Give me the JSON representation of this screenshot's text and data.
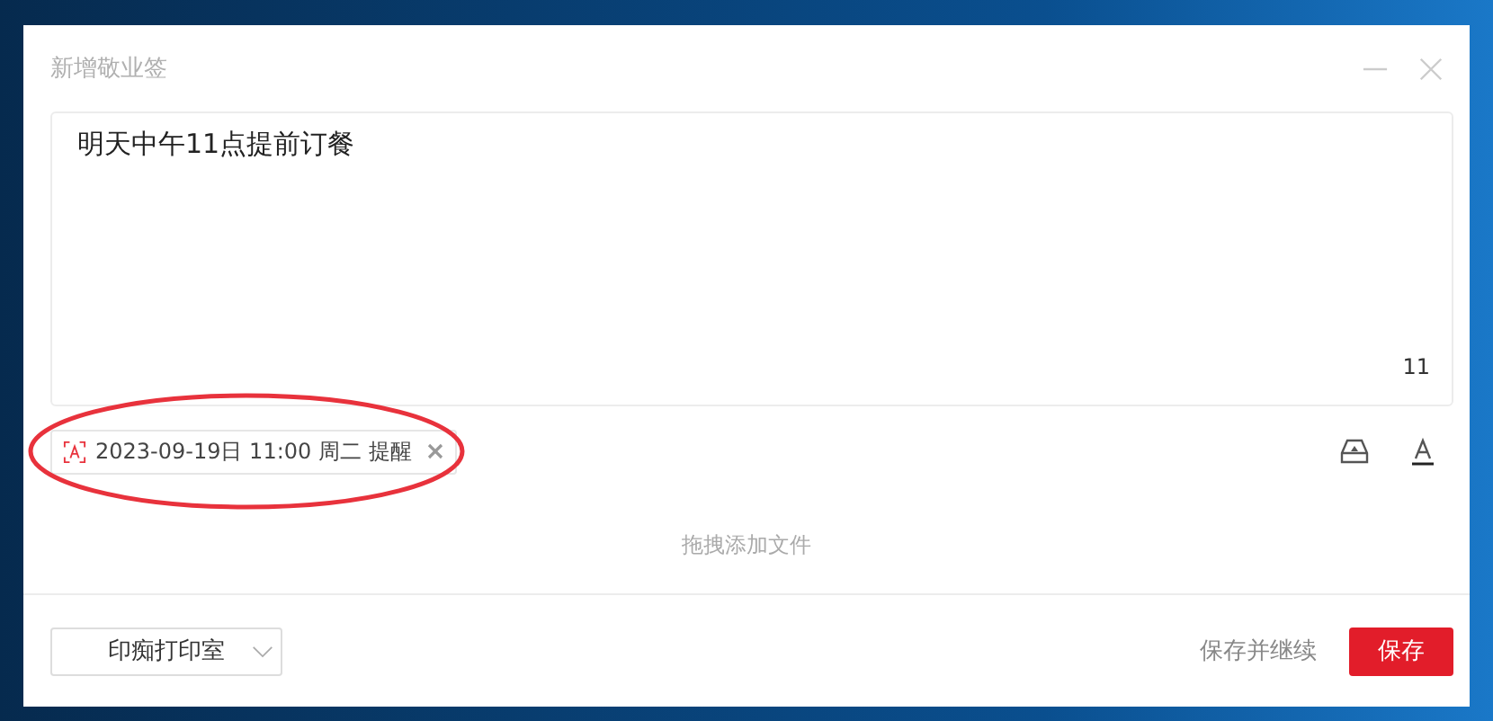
{
  "window": {
    "title": "新增敬业签"
  },
  "note": {
    "value": "明天中午11点提前订餐",
    "count": "11"
  },
  "reminder": {
    "label": "2023-09-19日 11:00 周二 提醒",
    "highlighted": true
  },
  "drop_hint": "拖拽添加文件",
  "footer": {
    "dropdown": "印痴打印室",
    "secondary_button": "保存并继续",
    "primary_button": "保存"
  }
}
